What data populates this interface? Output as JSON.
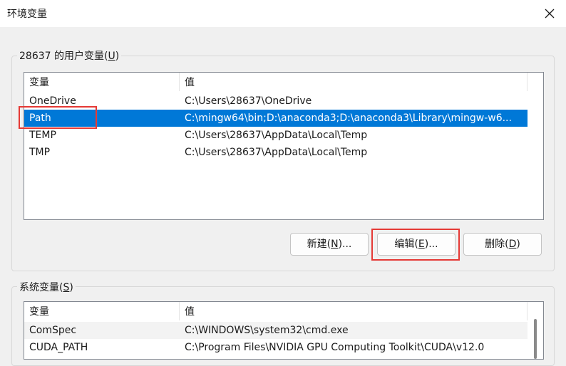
{
  "window": {
    "title": "环境变量",
    "close_icon": "close-icon"
  },
  "user_vars": {
    "group_label_prefix": "28637 的用户变量(",
    "group_label_key": "U",
    "group_label_suffix": ")",
    "col_name": "变量",
    "col_value": "值",
    "rows": [
      {
        "name": "OneDrive",
        "value": "C:\\Users\\28637\\OneDrive"
      },
      {
        "name": "Path",
        "value": "C:\\mingw64\\bin;D:\\anaconda3;D:\\anaconda3\\Library\\mingw-w6..."
      },
      {
        "name": "TEMP",
        "value": "C:\\Users\\28637\\AppData\\Local\\Temp"
      },
      {
        "name": "TMP",
        "value": "C:\\Users\\28637\\AppData\\Local\\Temp"
      }
    ],
    "selected_row": "Path",
    "buttons": {
      "new_prefix": "新建(",
      "new_key": "N",
      "new_suffix": ")...",
      "edit_prefix": "编辑(",
      "edit_key": "E",
      "edit_suffix": ")...",
      "delete_prefix": "删除(",
      "delete_key": "D",
      "delete_suffix": ")"
    }
  },
  "system_vars": {
    "group_label_prefix": "系统变量(",
    "group_label_key": "S",
    "group_label_suffix": ")",
    "col_name": "变量",
    "col_value": "值",
    "rows": [
      {
        "name": "ComSpec",
        "value": "C:\\WINDOWS\\system32\\cmd.exe"
      },
      {
        "name": "CUDA_PATH",
        "value": "C:\\Program Files\\NVIDIA GPU Computing Toolkit\\CUDA\\v12.0"
      }
    ]
  },
  "colors": {
    "selection": "#0078d7",
    "annotation": "#e53935"
  }
}
